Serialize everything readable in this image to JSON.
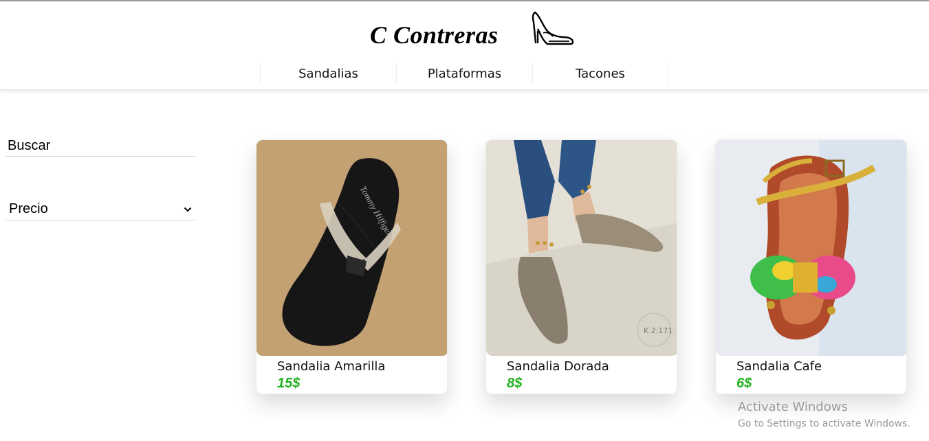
{
  "brand": {
    "name": "C Contreras",
    "logo_icon": "high-heel-shoe-icon"
  },
  "nav": {
    "items": [
      {
        "label": "Sandalias"
      },
      {
        "label": "Plataformas"
      },
      {
        "label": "Tacones"
      }
    ]
  },
  "filters": {
    "search_placeholder": "Buscar",
    "price_label": "Precio",
    "price_icon": "chevron-down-icon"
  },
  "products": [
    {
      "name": "Sandalia Amarilla",
      "price": "15$",
      "image": "black-flip-flop-sandal"
    },
    {
      "name": "Sandalia Dorada",
      "price": "8$",
      "image": "gold-pointed-flat-shoes"
    },
    {
      "name": "Sandalia Cafe",
      "price": "6$",
      "image": "brown-sandal-with-floral-bow"
    }
  ],
  "product_image_labels": {
    "brand_print": "Tommy Hilfiger",
    "watermark": "K 2:171"
  },
  "colors": {
    "price": "#22b21f",
    "text": "#111111"
  },
  "system_watermark": {
    "title": "Activate Windows",
    "subtitle": "Go to Settings to activate Windows."
  }
}
